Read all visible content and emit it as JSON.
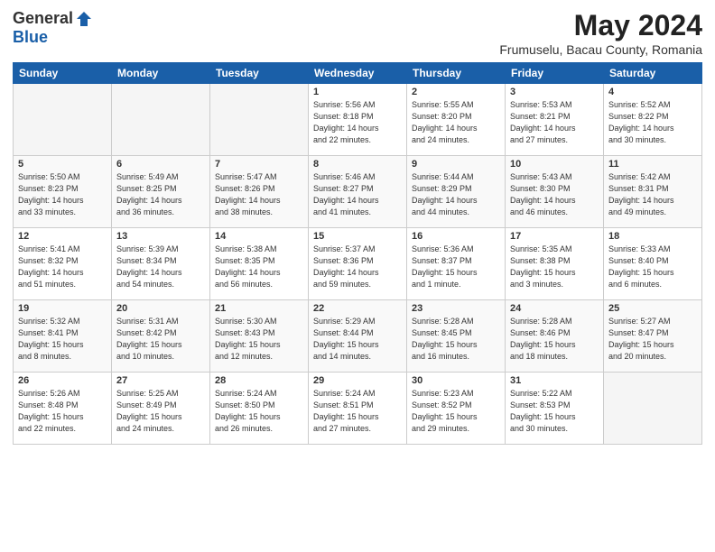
{
  "logo": {
    "general": "General",
    "blue": "Blue"
  },
  "title": "May 2024",
  "location": "Frumuselu, Bacau County, Romania",
  "days_of_week": [
    "Sunday",
    "Monday",
    "Tuesday",
    "Wednesday",
    "Thursday",
    "Friday",
    "Saturday"
  ],
  "weeks": [
    [
      {
        "num": "",
        "info": ""
      },
      {
        "num": "",
        "info": ""
      },
      {
        "num": "",
        "info": ""
      },
      {
        "num": "1",
        "info": "Sunrise: 5:56 AM\nSunset: 8:18 PM\nDaylight: 14 hours\nand 22 minutes."
      },
      {
        "num": "2",
        "info": "Sunrise: 5:55 AM\nSunset: 8:20 PM\nDaylight: 14 hours\nand 24 minutes."
      },
      {
        "num": "3",
        "info": "Sunrise: 5:53 AM\nSunset: 8:21 PM\nDaylight: 14 hours\nand 27 minutes."
      },
      {
        "num": "4",
        "info": "Sunrise: 5:52 AM\nSunset: 8:22 PM\nDaylight: 14 hours\nand 30 minutes."
      }
    ],
    [
      {
        "num": "5",
        "info": "Sunrise: 5:50 AM\nSunset: 8:23 PM\nDaylight: 14 hours\nand 33 minutes."
      },
      {
        "num": "6",
        "info": "Sunrise: 5:49 AM\nSunset: 8:25 PM\nDaylight: 14 hours\nand 36 minutes."
      },
      {
        "num": "7",
        "info": "Sunrise: 5:47 AM\nSunset: 8:26 PM\nDaylight: 14 hours\nand 38 minutes."
      },
      {
        "num": "8",
        "info": "Sunrise: 5:46 AM\nSunset: 8:27 PM\nDaylight: 14 hours\nand 41 minutes."
      },
      {
        "num": "9",
        "info": "Sunrise: 5:44 AM\nSunset: 8:29 PM\nDaylight: 14 hours\nand 44 minutes."
      },
      {
        "num": "10",
        "info": "Sunrise: 5:43 AM\nSunset: 8:30 PM\nDaylight: 14 hours\nand 46 minutes."
      },
      {
        "num": "11",
        "info": "Sunrise: 5:42 AM\nSunset: 8:31 PM\nDaylight: 14 hours\nand 49 minutes."
      }
    ],
    [
      {
        "num": "12",
        "info": "Sunrise: 5:41 AM\nSunset: 8:32 PM\nDaylight: 14 hours\nand 51 minutes."
      },
      {
        "num": "13",
        "info": "Sunrise: 5:39 AM\nSunset: 8:34 PM\nDaylight: 14 hours\nand 54 minutes."
      },
      {
        "num": "14",
        "info": "Sunrise: 5:38 AM\nSunset: 8:35 PM\nDaylight: 14 hours\nand 56 minutes."
      },
      {
        "num": "15",
        "info": "Sunrise: 5:37 AM\nSunset: 8:36 PM\nDaylight: 14 hours\nand 59 minutes."
      },
      {
        "num": "16",
        "info": "Sunrise: 5:36 AM\nSunset: 8:37 PM\nDaylight: 15 hours\nand 1 minute."
      },
      {
        "num": "17",
        "info": "Sunrise: 5:35 AM\nSunset: 8:38 PM\nDaylight: 15 hours\nand 3 minutes."
      },
      {
        "num": "18",
        "info": "Sunrise: 5:33 AM\nSunset: 8:40 PM\nDaylight: 15 hours\nand 6 minutes."
      }
    ],
    [
      {
        "num": "19",
        "info": "Sunrise: 5:32 AM\nSunset: 8:41 PM\nDaylight: 15 hours\nand 8 minutes."
      },
      {
        "num": "20",
        "info": "Sunrise: 5:31 AM\nSunset: 8:42 PM\nDaylight: 15 hours\nand 10 minutes."
      },
      {
        "num": "21",
        "info": "Sunrise: 5:30 AM\nSunset: 8:43 PM\nDaylight: 15 hours\nand 12 minutes."
      },
      {
        "num": "22",
        "info": "Sunrise: 5:29 AM\nSunset: 8:44 PM\nDaylight: 15 hours\nand 14 minutes."
      },
      {
        "num": "23",
        "info": "Sunrise: 5:28 AM\nSunset: 8:45 PM\nDaylight: 15 hours\nand 16 minutes."
      },
      {
        "num": "24",
        "info": "Sunrise: 5:28 AM\nSunset: 8:46 PM\nDaylight: 15 hours\nand 18 minutes."
      },
      {
        "num": "25",
        "info": "Sunrise: 5:27 AM\nSunset: 8:47 PM\nDaylight: 15 hours\nand 20 minutes."
      }
    ],
    [
      {
        "num": "26",
        "info": "Sunrise: 5:26 AM\nSunset: 8:48 PM\nDaylight: 15 hours\nand 22 minutes."
      },
      {
        "num": "27",
        "info": "Sunrise: 5:25 AM\nSunset: 8:49 PM\nDaylight: 15 hours\nand 24 minutes."
      },
      {
        "num": "28",
        "info": "Sunrise: 5:24 AM\nSunset: 8:50 PM\nDaylight: 15 hours\nand 26 minutes."
      },
      {
        "num": "29",
        "info": "Sunrise: 5:24 AM\nSunset: 8:51 PM\nDaylight: 15 hours\nand 27 minutes."
      },
      {
        "num": "30",
        "info": "Sunrise: 5:23 AM\nSunset: 8:52 PM\nDaylight: 15 hours\nand 29 minutes."
      },
      {
        "num": "31",
        "info": "Sunrise: 5:22 AM\nSunset: 8:53 PM\nDaylight: 15 hours\nand 30 minutes."
      },
      {
        "num": "",
        "info": ""
      }
    ]
  ]
}
